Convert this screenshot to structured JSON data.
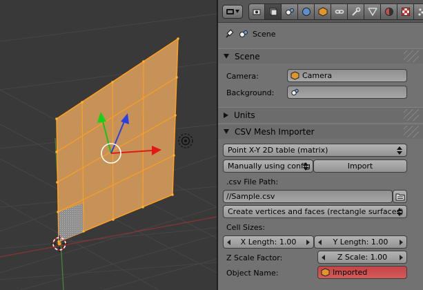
{
  "context": {
    "label": "Scene"
  },
  "sections": {
    "scene": {
      "title": "Scene",
      "camera_label": "Camera:",
      "camera_value": "Camera",
      "background_label": "Background:",
      "background_value": ""
    },
    "units": {
      "title": "Units"
    },
    "csv": {
      "title": "CSV Mesh Importer",
      "table_type": "Point X-Y 2D table (matrix)",
      "config_mode": "Manually using config",
      "import_button": "Import",
      "file_path_label": ".csv File Path:",
      "file_path_value": "//Sample.csv",
      "mesh_mode": "Create vertices and faces (rectangle surfaces)",
      "cell_sizes_label": "Cell Sizes:",
      "x_length": "X Length: 1.00",
      "y_length": "Y Length: 1.00",
      "z_scale_label": "Z Scale Factor:",
      "z_scale": "Z Scale: 1.00",
      "object_name_label": "Object Name:",
      "object_name_value": "Imported"
    }
  },
  "colors": {
    "mesh_face": "#d49a5a",
    "mesh_edge": "#ffa020",
    "axis_x": "#e01818",
    "axis_y": "#18d018",
    "axis_z": "#2a40e0",
    "object_name_field": "#d04b4b"
  },
  "tabs": [
    "render-icon",
    "render-layers-icon",
    "scene-icon",
    "world-icon",
    "object-icon",
    "constraints-icon",
    "modifiers-icon",
    "data-icon",
    "material-icon",
    "texture-icon",
    "particles-icon"
  ]
}
